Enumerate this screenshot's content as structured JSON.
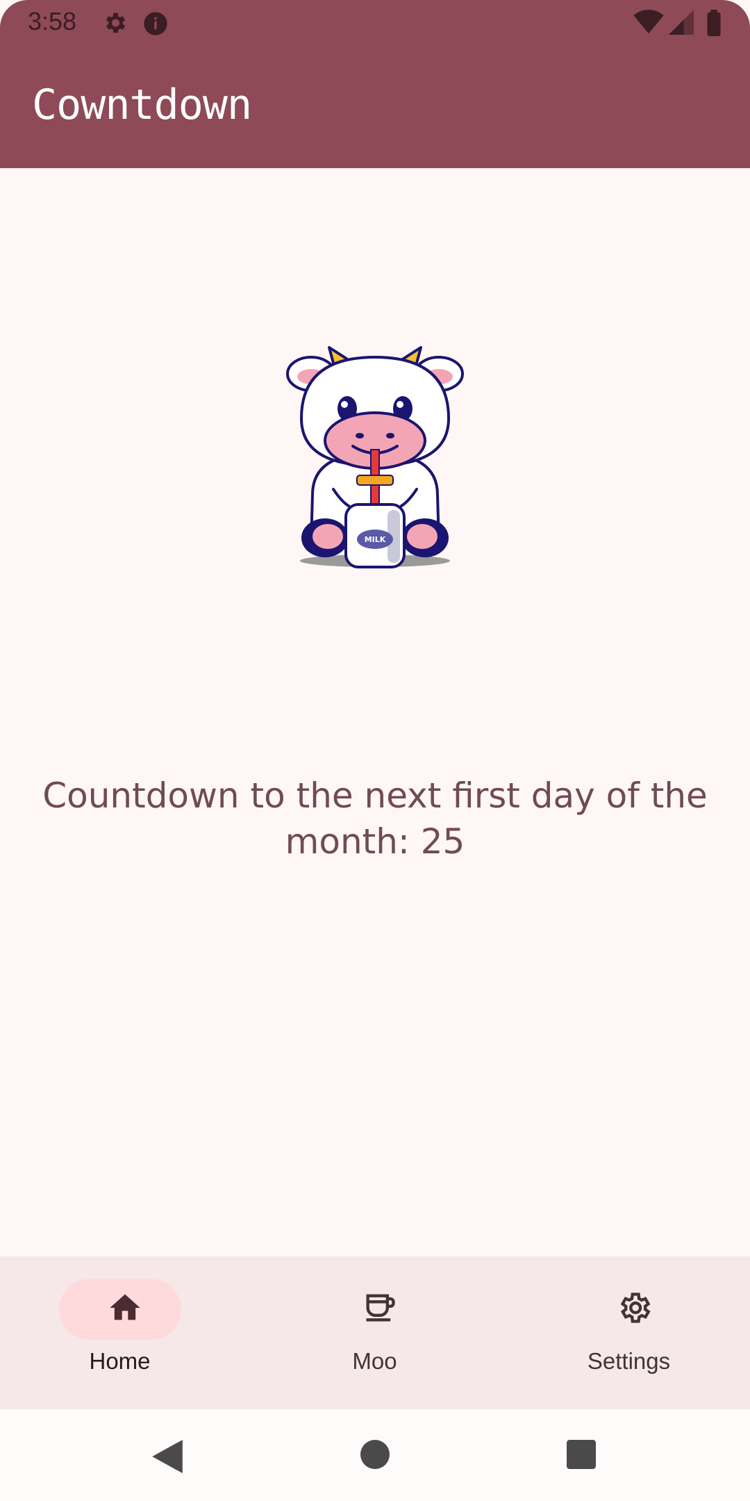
{
  "status_bar": {
    "time": "3:58",
    "icons": [
      "settings-icon",
      "info-icon",
      "wifi-icon",
      "signal-icon",
      "battery-icon"
    ]
  },
  "app_bar": {
    "title": "Cowntdown"
  },
  "main": {
    "illustration": "cow-drinking-milk",
    "bottle_label": "MILK",
    "countdown_text": "Countdown to the next first day of the month: 25"
  },
  "bottom_nav": {
    "items": [
      {
        "label": "Home",
        "icon": "home-icon",
        "selected": true
      },
      {
        "label": "Moo",
        "icon": "cup-icon",
        "selected": false
      },
      {
        "label": "Settings",
        "icon": "gear-icon",
        "selected": false
      }
    ]
  },
  "system_nav": {
    "buttons": [
      "back-icon",
      "home-circle-icon",
      "recents-icon"
    ]
  },
  "colors": {
    "app_bar": "#8e4a57",
    "background": "#fff7f6",
    "nav_background": "#f6e8e8",
    "nav_indicator": "#ffdadd",
    "text": "#6f4b52"
  }
}
